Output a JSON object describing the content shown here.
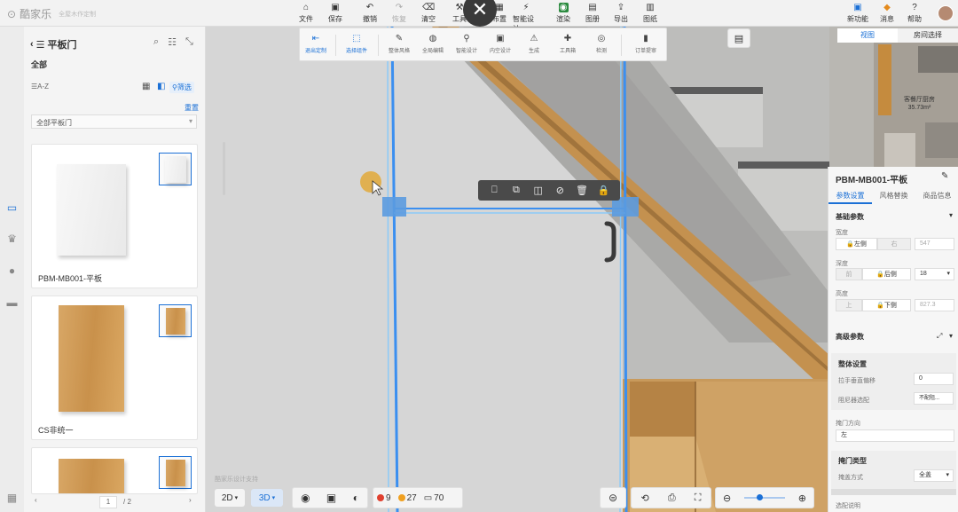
{
  "app": {
    "logo_text": "酷家乐",
    "logo_sub": "全屋木作定制"
  },
  "topbar": {
    "items": [
      {
        "label": "文件",
        "icon": "home-icon"
      },
      {
        "label": "保存",
        "icon": "save-icon"
      },
      {
        "label": "撤销",
        "icon": "undo-icon"
      },
      {
        "label": "恢复",
        "icon": "redo-icon"
      },
      {
        "label": "清空",
        "icon": "eraser-icon"
      },
      {
        "label": "工具",
        "icon": "tools-icon"
      },
      {
        "label": "布置",
        "icon": "layout-icon"
      },
      {
        "label": "智能设计",
        "icon": "lightning-icon"
      },
      {
        "label": "渲染",
        "icon": "camera-icon"
      },
      {
        "label": "图册",
        "icon": "album-icon"
      },
      {
        "label": "导出",
        "icon": "export-icon"
      },
      {
        "label": "图纸",
        "icon": "drawing-icon"
      }
    ],
    "right": [
      {
        "label": "新功能",
        "icon": "new-feature-icon"
      },
      {
        "label": "消息",
        "icon": "gift-icon"
      },
      {
        "label": "帮助",
        "icon": "help-icon"
      }
    ]
  },
  "subbar": {
    "items": [
      {
        "label": "退出定制",
        "active": true
      },
      {
        "label": "选择组件",
        "active": true
      },
      {
        "label": "整体风格",
        "active": false
      },
      {
        "label": "全局编辑",
        "active": false
      },
      {
        "label": "智能设计",
        "active": false
      },
      {
        "label": "内空设计",
        "active": false
      },
      {
        "label": "生成",
        "active": false
      },
      {
        "label": "工具箱",
        "active": false
      },
      {
        "label": "检测",
        "active": false
      },
      {
        "label": "订单提审",
        "active": false
      }
    ]
  },
  "catalog": {
    "title": "平板门",
    "breadcrumb": "全部",
    "sort_label": "A-Z",
    "filter_label": "筛选",
    "link_label": "重置",
    "select_value": "全部平板门",
    "items": [
      {
        "name": "PBM-MB001-平板",
        "material": "white"
      },
      {
        "name": "CS非统一",
        "material": "wood"
      },
      {
        "name": "",
        "material": "wood"
      }
    ],
    "pager": {
      "current": "1",
      "total": "/ 2"
    }
  },
  "viewport": {
    "watermark": "酷家乐设计支持",
    "context_toolbar": [
      "door-icon",
      "copy-icon",
      "mirror-icon",
      "hide-icon",
      "delete-icon",
      "lock-icon"
    ],
    "bottom": {
      "view_2d": "2D",
      "view_3d": "3D",
      "errors": "9",
      "warnings": "27",
      "items": "70"
    }
  },
  "minimap": {
    "tabs": [
      "视图",
      "房间选择"
    ],
    "room_label": "客餐厅厨房",
    "room_area": "35.73m²"
  },
  "properties": {
    "title": "PBM-MB001-平板",
    "tabs": [
      "参数设置",
      "风格替换",
      "商品信息"
    ],
    "basic_section": "基础参数",
    "width_label": "宽度",
    "width_left": "左侧",
    "width_right": "右",
    "width_value": "547",
    "depth_label": "深度",
    "depth_front": "前",
    "depth_back": "后侧",
    "depth_value": "18",
    "height_label": "高度",
    "height_top": "上",
    "height_bottom": "下侧",
    "height_value": "827.3",
    "advanced_section": "高级参数",
    "overall_group": "整体设置",
    "handle_offset_label": "拉手垂直偏移",
    "handle_offset_value": "0",
    "hinge_label": "阻尼器选配",
    "hinge_value": "不配阻...",
    "open_dir_label": "掩门方向",
    "open_dir_value": "左",
    "door_type_group": "掩门类型",
    "cover_label": "掩盖方式",
    "cover_value": "全盖",
    "footer_label": "选配说明"
  }
}
